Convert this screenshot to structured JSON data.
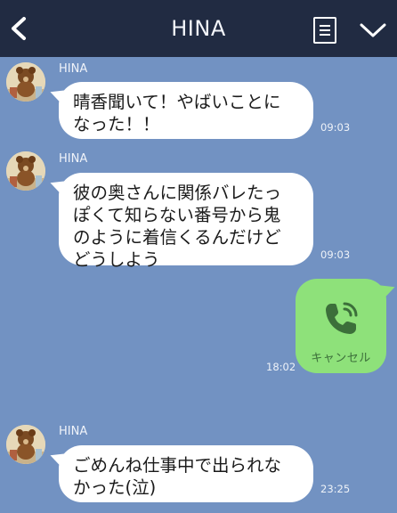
{
  "header": {
    "title": "HINA",
    "back_icon": "chevron-left-icon",
    "menu_icon": "note-list-icon",
    "collapse_icon": "chevron-down-icon"
  },
  "messages": [
    {
      "sender": "HINA",
      "lines": [
        "晴香聞いて！やばいことに",
        "なった！！"
      ],
      "time": "09:03"
    },
    {
      "sender": "HINA",
      "lines": [
        "彼の奥さんに関係バレたっ",
        "ぽくて知らない番号から鬼",
        "のように着信くるんだけど",
        "どうしよう"
      ],
      "time": "09:03"
    },
    {
      "call_label": "キャンセル",
      "call_icon": "phone-call-icon",
      "time": "18:02"
    },
    {
      "sender": "HINA",
      "lines": [
        "ごめんね仕事中で出られな",
        "かった(泣)"
      ],
      "time": "23:25"
    }
  ],
  "colors": {
    "background": "#7292c2",
    "header": "#212b42",
    "own_bubble": "#8ee17a",
    "other_bubble": "#ffffff"
  }
}
